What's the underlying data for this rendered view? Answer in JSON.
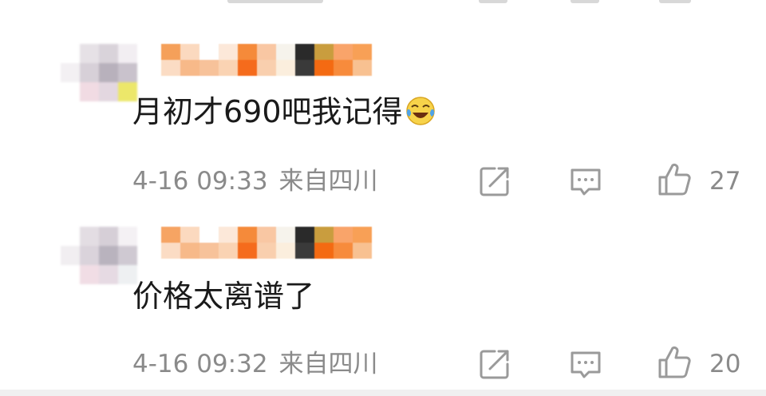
{
  "comments": [
    {
      "text": "月初才690吧我记得",
      "emoji": "laugh-cry-emoji",
      "time": "4-16 09:33",
      "location": "来自四川",
      "likes": "27"
    },
    {
      "text": "价格太离谱了",
      "time": "4-16 09:32",
      "location": "来自四川",
      "likes": "20"
    }
  ],
  "icons": {
    "share": "share-icon",
    "reply": "reply-icon",
    "like": "thumbs-up-icon"
  },
  "colors": {
    "text": "#1a1a1a",
    "meta": "#8a8a8a",
    "icon": "#9a9a9a",
    "username_tints": [
      "#f4a15c",
      "#fbe3cf",
      "#f46b1e",
      "#2b2b2b",
      "#c89a3c"
    ]
  }
}
